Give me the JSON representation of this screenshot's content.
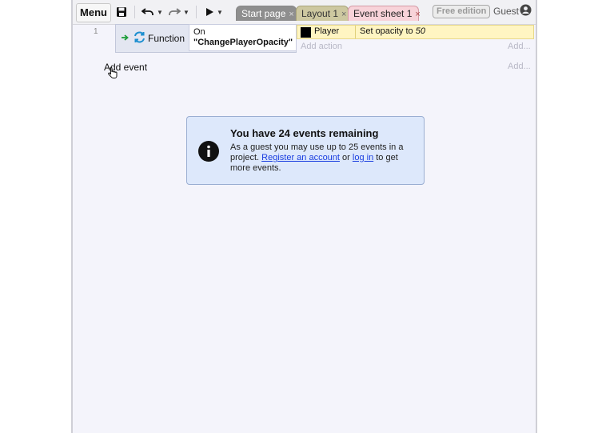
{
  "toolbar": {
    "menu_label": "Menu",
    "tabs": [
      {
        "label": "Start page",
        "close": "×"
      },
      {
        "label": "Layout 1",
        "close": "×"
      },
      {
        "label": "Event sheet 1",
        "close": "×"
      }
    ],
    "free_edition_label": "Free edition",
    "guest_label": "Guest"
  },
  "event_sheet": {
    "events": [
      {
        "line_number": "1",
        "trigger_label": "Function",
        "condition": {
          "prefix": "On",
          "name": "\"ChangePlayerOpacity\""
        },
        "action": {
          "object": "Player",
          "text": "Set opacity to",
          "value": "50"
        }
      }
    ],
    "add_action_label": "Add action",
    "add_right_label": "Add...",
    "add_event_label": "Add event"
  },
  "notice": {
    "title": "You have 24 events remaining",
    "body_part1": "As a guest you may use up to 25 events in a project.",
    "register_link": "Register an account",
    "body_or": "or",
    "login_link": "log in",
    "body_part2": "to get more events."
  },
  "colors": {
    "tab_start": "#8e8e8e",
    "tab_layout": "#cdc8a0",
    "tab_sheet": "#f8d3d9",
    "action_row": "#fff5c2",
    "notice_bg": "#dde8fb",
    "link": "#1a3ee0"
  }
}
